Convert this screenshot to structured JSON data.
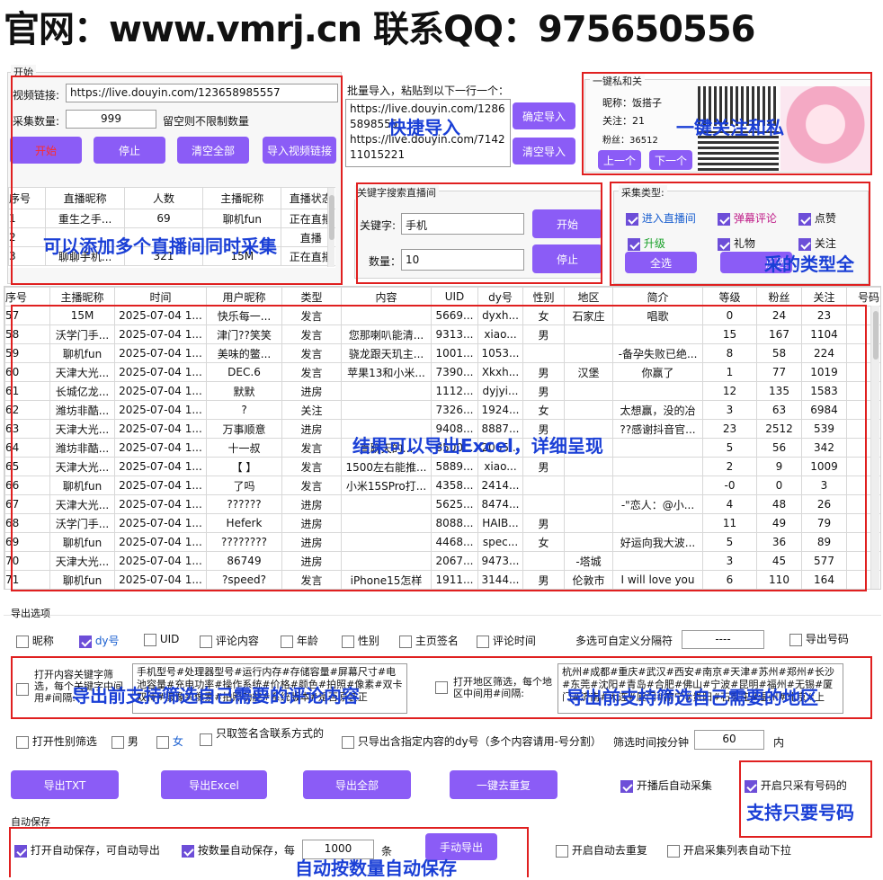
{
  "banner": "官网：www.vmrj.cn 联系QQ：975650556",
  "collect": {
    "group_title": "开始",
    "url_label": "视频链接:",
    "url_value": "https://live.douyin.com/123658985557",
    "count_label": "采集数量:",
    "count_value": "999",
    "count_hint": "留空则不限制数量",
    "btn_start": "开始",
    "btn_stop": "停止",
    "btn_clear": "清空全部",
    "btn_import": "导入视频链接",
    "room_headers": [
      "序号",
      "直播昵称",
      "人数",
      "主播昵称",
      "直播状态"
    ],
    "rooms": [
      [
        "1",
        "重生之手...",
        "69",
        "聊机fun",
        "正在直播"
      ],
      [
        "2",
        "",
        "",
        "",
        "直播"
      ],
      [
        "3",
        "聊聊手机...",
        "321",
        "15M",
        "正在直播"
      ]
    ]
  },
  "batch": {
    "title": "批量导入，粘贴到以下一行一个：",
    "text": "https://live.douyin.com/12865898555\nhttps://live.douyin.com/714211015221",
    "btn_confirm": "确定导入",
    "btn_clear": "清空导入"
  },
  "follow": {
    "title": "一键私和关",
    "nick_label": "昵称：",
    "nick": "饭搭子",
    "follow_label": "关注：",
    "follow": "21",
    "fans_label": "粉丝：",
    "fans": "36512",
    "btn_prev": "上一个",
    "btn_next": "下一个"
  },
  "keyword": {
    "title": "关键字搜索直播间",
    "kw_label": "关键字:",
    "kw_value": "手机",
    "num_label": "数量：",
    "num_value": "10",
    "btn_start": "开始",
    "btn_stop": "停止"
  },
  "types": {
    "title": "采集类型:",
    "items": [
      {
        "label": "进入直播间",
        "checked": true,
        "color": "#1a5fd0"
      },
      {
        "label": "弹幕评论",
        "checked": true,
        "color": "#c0208a"
      },
      {
        "label": "点赞",
        "checked": true,
        "color": "#111"
      },
      {
        "label": "升级",
        "checked": true,
        "color": "#1aa12a"
      },
      {
        "label": "礼物",
        "checked": true,
        "color": "#111"
      },
      {
        "label": "关注",
        "checked": true,
        "color": "#111"
      }
    ],
    "btn_all": "全选",
    "btn_invert": "反选"
  },
  "results": {
    "headers": [
      "序号",
      "主播昵称",
      "时间",
      "用户昵称",
      "类型",
      "内容",
      "UID",
      "dy号",
      "性别",
      "地区",
      "简介",
      "等级",
      "粉丝",
      "关注",
      "号码"
    ],
    "rows": [
      [
        "57",
        "15M",
        "2025-07-04 1...",
        "快乐每一...",
        "发言",
        "",
        "5669...",
        "dyxh...",
        "女",
        "石家庄",
        "唱歌",
        "0",
        "24",
        "23",
        ""
      ],
      [
        "58",
        "沃学门手...",
        "2025-07-04 1...",
        "津门??笑笑",
        "发言",
        "您那喇叭能清...",
        "9313...",
        "xiao...",
        "男",
        "",
        "",
        "15",
        "167",
        "1104",
        ""
      ],
      [
        "59",
        "聊机fun",
        "2025-07-04 1...",
        "美味的鳖...",
        "发言",
        "骁龙跟天玑主...",
        "1001...",
        "1053...",
        "",
        "",
        "-备孕失败已绝...",
        "8",
        "58",
        "224",
        ""
      ],
      [
        "60",
        "天津大光...",
        "2025-07-04 1...",
        "DEC.6",
        "发言",
        "苹果13和小米...",
        "7390...",
        "Xkxh...",
        "男",
        "汉堡",
        "你赢了",
        "1",
        "77",
        "1019",
        ""
      ],
      [
        "61",
        "长城亿龙...",
        "2025-07-04 1...",
        "默默",
        "进房",
        "",
        "1112...",
        "dyjyi...",
        "男",
        "",
        "",
        "12",
        "135",
        "1583",
        ""
      ],
      [
        "62",
        "潍坊非酷...",
        "2025-07-04 1...",
        "?",
        "关注",
        "",
        "7326...",
        "1924...",
        "女",
        "",
        "太想赢，没的冶",
        "3",
        "63",
        "6984",
        ""
      ],
      [
        "63",
        "天津大光...",
        "2025-07-04 1...",
        "万事顺意",
        "进房",
        "",
        "9408...",
        "8887...",
        "男",
        "",
        "??感谢抖音官...",
        "23",
        "2512",
        "539",
        ""
      ],
      [
        "64",
        "潍坊非酷...",
        "2025-07-04 1...",
        "十一叔",
        "发言",
        "直聊天的...",
        "8500...",
        "2065...",
        "",
        "",
        "",
        "5",
        "56",
        "342",
        ""
      ],
      [
        "65",
        "天津大光...",
        "2025-07-04 1...",
        "【 】",
        "发言",
        "1500左右能推...",
        "5889...",
        "xiao...",
        "男",
        "",
        "",
        "2",
        "9",
        "1009",
        ""
      ],
      [
        "66",
        "聊机fun",
        "2025-07-04 1...",
        "了吗",
        "发言",
        "小米15SPro打...",
        "4358...",
        "2414...",
        "",
        "",
        "",
        "-0",
        "0",
        "3",
        ""
      ],
      [
        "67",
        "天津大光...",
        "2025-07-04 1...",
        "??????",
        "进房",
        "",
        "5625...",
        "8474...",
        "",
        "",
        "-\"恋人：@小...",
        "4",
        "48",
        "26",
        ""
      ],
      [
        "68",
        "沃学门手...",
        "2025-07-04 1...",
        "Heferk",
        "进房",
        "",
        "8088...",
        "HAIB...",
        "男",
        "",
        "",
        "11",
        "49",
        "79",
        ""
      ],
      [
        "69",
        "聊机fun",
        "2025-07-04 1...",
        "????????",
        "进房",
        "",
        "4468...",
        "spec...",
        "女",
        "",
        "好运向我大波...",
        "5",
        "36",
        "89",
        ""
      ],
      [
        "70",
        "天津大光...",
        "2025-07-04 1...",
        "86749",
        "进房",
        "",
        "2067...",
        "9473...",
        "",
        "-塔城",
        "",
        "3",
        "45",
        "577",
        ""
      ],
      [
        "71",
        "聊机fun",
        "2025-07-04 1...",
        "?speed?",
        "发言",
        "iPhone15怎样",
        "1911...",
        "3144...",
        "男",
        "伦敦市",
        "I will love you",
        "6",
        "110",
        "164",
        ""
      ]
    ]
  },
  "export": {
    "title": "导出选项",
    "fields": [
      {
        "label": "昵称",
        "checked": false
      },
      {
        "label": "dy号",
        "checked": true
      },
      {
        "label": "UID",
        "checked": false
      },
      {
        "label": "评论内容",
        "checked": false
      },
      {
        "label": "年龄",
        "checked": false
      },
      {
        "label": "性别",
        "checked": false
      },
      {
        "label": "主页签名",
        "checked": false
      },
      {
        "label": "评论时间",
        "checked": false
      }
    ],
    "sep_label": "多选可自定义分隔符",
    "sep_value": "----",
    "export_phone": "导出号码",
    "kw_filter_label": "打开内容关键字筛选，每个关键字中间用#间隔:",
    "kw_filter_value": "手机型号#处理器型号#运行内存#存储容量#屏幕尺寸#电池容量#充电功率#操作系统#价格#颜色#拍照#像素#双卡双待#摄像头像素#拍照功能#系统版本#是否原装正",
    "area_filter_label": "打开地区筛选，每个地区中间用#间隔:",
    "area_filter_value": "杭州#成都#重庆#武汉#西安#南京#天津#苏州#郑州#长沙#东莞#沈阳#青岛#合肥#佛山#宁波#昆明#福州#无锡#厦门#济南#大连#厦门#南宁#贵阳#石家庄#温州#北京#上",
    "gender_filter": "打开性别筛选",
    "male": "男",
    "female": "女",
    "sign_contact": "只取签名含联系方式的",
    "dy_contain": "只导出含指定内容的dy号（多个内容请用-号分割）",
    "time_label": "筛选时间按分钟",
    "time_value": "60",
    "time_unit": "内",
    "btn_txt": "导出TXT",
    "btn_excel": "导出Excel",
    "btn_all": "导出全部",
    "btn_dedupe": "一键去重复",
    "auto_collect": "开播后自动采集",
    "phone_only": "开启只采有号码的"
  },
  "autosave": {
    "title": "自动保存",
    "open_auto": "打开自动保存，可自动导出",
    "by_count": "按数量自动保存，每",
    "count_value": "1000",
    "unit": "条",
    "btn_manual": "手动导出",
    "auto_dedupe": "开启自动去重复",
    "auto_scroll": "开启采集列表自动下拉"
  },
  "annotations": {
    "quick_import": "快捷导入",
    "follow_msg": "一键关注和私",
    "multi_room": "可以添加多个直播间同时采集",
    "types_full": "采的类型全",
    "excel": "结果可以导出Excel，详细呈现",
    "filter_comment": "导出前支持筛选自己需要的评论内容",
    "filter_area": "导出前支持筛选自己需要的地区",
    "phone_only": "支持只要号码",
    "auto_save": "自动按数量自动保存"
  }
}
